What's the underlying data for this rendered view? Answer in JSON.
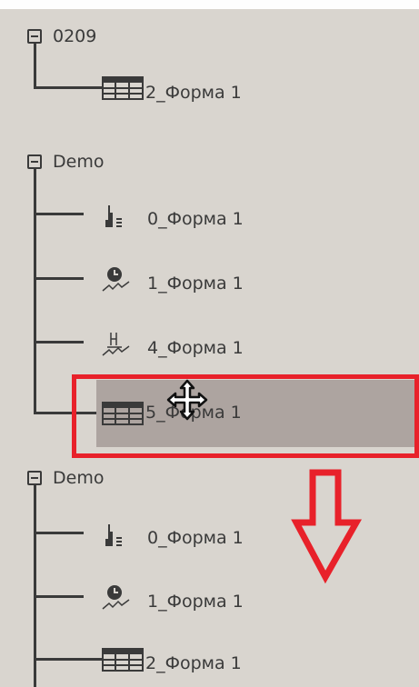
{
  "tree": {
    "groups": [
      {
        "label": "0209",
        "items": [
          {
            "label": "2_Форма 1",
            "icon": "table-icon"
          }
        ]
      },
      {
        "label": "Demo",
        "items": [
          {
            "label": "0_Форма 1",
            "icon": "bar-chart-icon"
          },
          {
            "label": "1_Форма 1",
            "icon": "clock-chart-icon"
          },
          {
            "label": "4_Форма 1",
            "icon": "line-chart-icon"
          },
          {
            "label": "5_Форма 1",
            "icon": "table-icon",
            "state": "dragging"
          }
        ]
      },
      {
        "label": "Demo",
        "items": [
          {
            "label": "0_Форма 1",
            "icon": "bar-chart-icon"
          },
          {
            "label": "1_Форма 1",
            "icon": "clock-chart-icon"
          },
          {
            "label": "2_Форма 1",
            "icon": "table-icon"
          }
        ]
      }
    ]
  },
  "annotation": {
    "highlight_color": "#e8212a",
    "arrow_direction": "down",
    "cursor": "move-cursor-icon"
  },
  "colors": {
    "panel_background": "#d9d5cf",
    "drag_highlight": "#ada4a0",
    "text": "#3a3a3a"
  }
}
